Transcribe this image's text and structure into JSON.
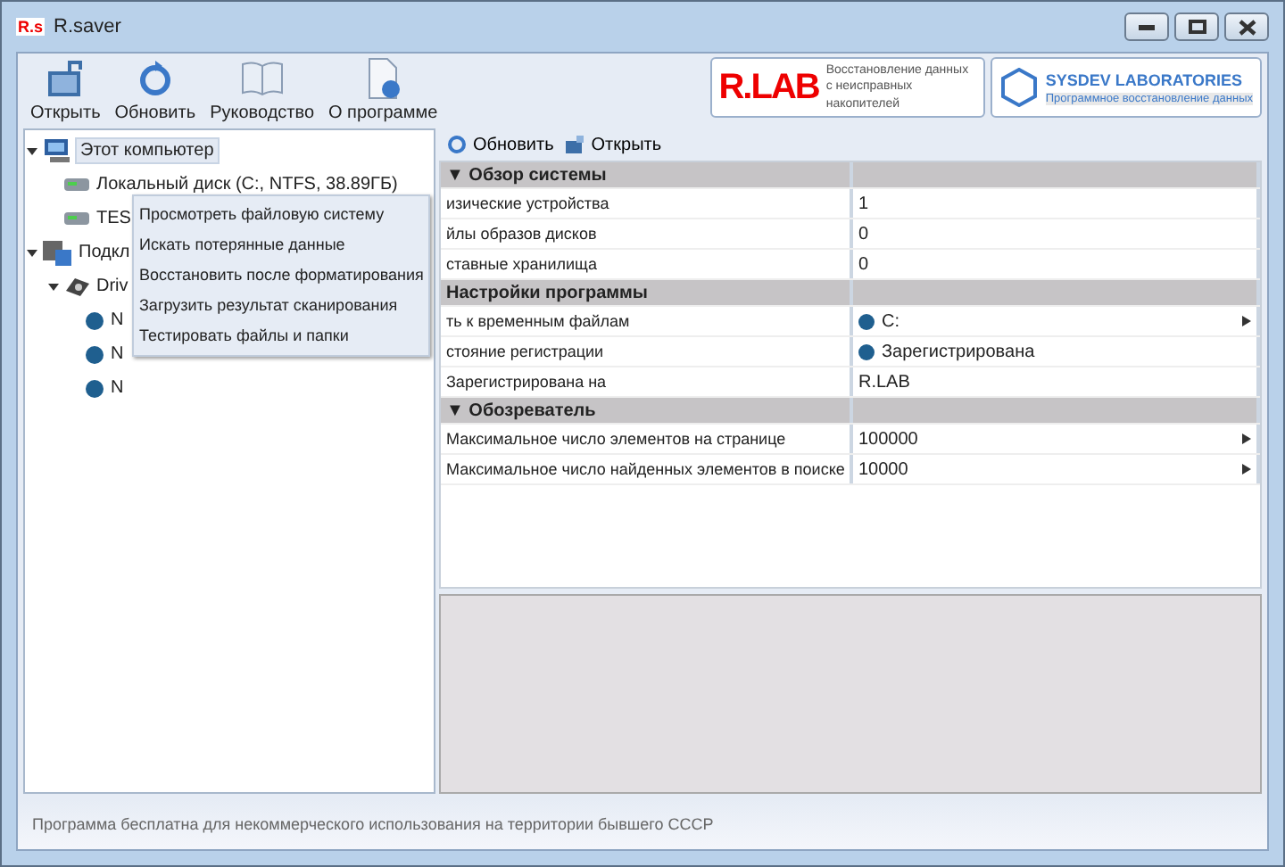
{
  "window": {
    "title": "R.saver",
    "app_icon": "R.s"
  },
  "toolbar": [
    "Открыть",
    "Обновить",
    "Руководство",
    "О программе"
  ],
  "banners": [
    {
      "kind": "rlab",
      "logo": "R.LAB",
      "text": "Восстановление данных с неисправных накопителей"
    },
    {
      "kind": "sysdev",
      "logo": "SYSDEV LABORATORIES",
      "text": "Программное восстановление данных"
    }
  ],
  "tree": [
    {
      "kind": "computer",
      "label": "Этот компьютер",
      "expanded": true,
      "selected": true,
      "children": [
        {
          "kind": "disk",
          "label": "Локальный диск (C:, NTFS, 38.89ГБ)",
          "selected": false
        },
        {
          "kind": "disk",
          "label": "TES",
          "selected": false
        }
      ]
    },
    {
      "kind": "group",
      "label": "Подкл",
      "expanded": true,
      "selected": false,
      "children": [
        {
          "kind": "drive",
          "label": "Driv",
          "expanded": true,
          "selected": false,
          "children": [
            {
              "kind": "partition",
              "label": "N",
              "selected": false
            },
            {
              "kind": "partition",
              "label": "N",
              "selected": false
            },
            {
              "kind": "partition",
              "label": "N",
              "selected": false
            }
          ]
        }
      ]
    }
  ],
  "context_menu": [
    "Просмотреть файловую систему",
    "Искать потерянные данные",
    "Восстановить после форматирования",
    "Загрузить результат сканирования",
    "Тестировать файлы и папки"
  ],
  "panel_toolbar": [
    "Обновить",
    "Открыть"
  ],
  "properties": [
    {
      "kind": "header",
      "name": "▼ Обзор системы"
    },
    {
      "kind": "row",
      "name": "изические устройства",
      "value": "1"
    },
    {
      "kind": "row",
      "name": "йлы образов дисков",
      "value": "0"
    },
    {
      "kind": "row",
      "name": "ставные хранилища",
      "value": "0"
    },
    {
      "kind": "header",
      "name": "Настройки программы"
    },
    {
      "kind": "row",
      "name": "ть к временным файлам",
      "value": "C:",
      "dot": true,
      "submenu": true
    },
    {
      "kind": "row",
      "name": "стояние регистрации",
      "value": "Зарегистрирована",
      "dot": true
    },
    {
      "kind": "row",
      "name": "Зарегистрирована на",
      "value": "R.LAB"
    },
    {
      "kind": "header",
      "name": "▼ Обозреватель"
    },
    {
      "kind": "row",
      "name": "Максимальное число элементов на странице",
      "value": "100000",
      "submenu": true
    },
    {
      "kind": "row",
      "name": "Максимальное число найденных элементов в поиске",
      "value": "10000",
      "submenu": true
    }
  ],
  "status_bar": "Программа бесплатна для некоммерческого использования на территории бывшего СССР"
}
